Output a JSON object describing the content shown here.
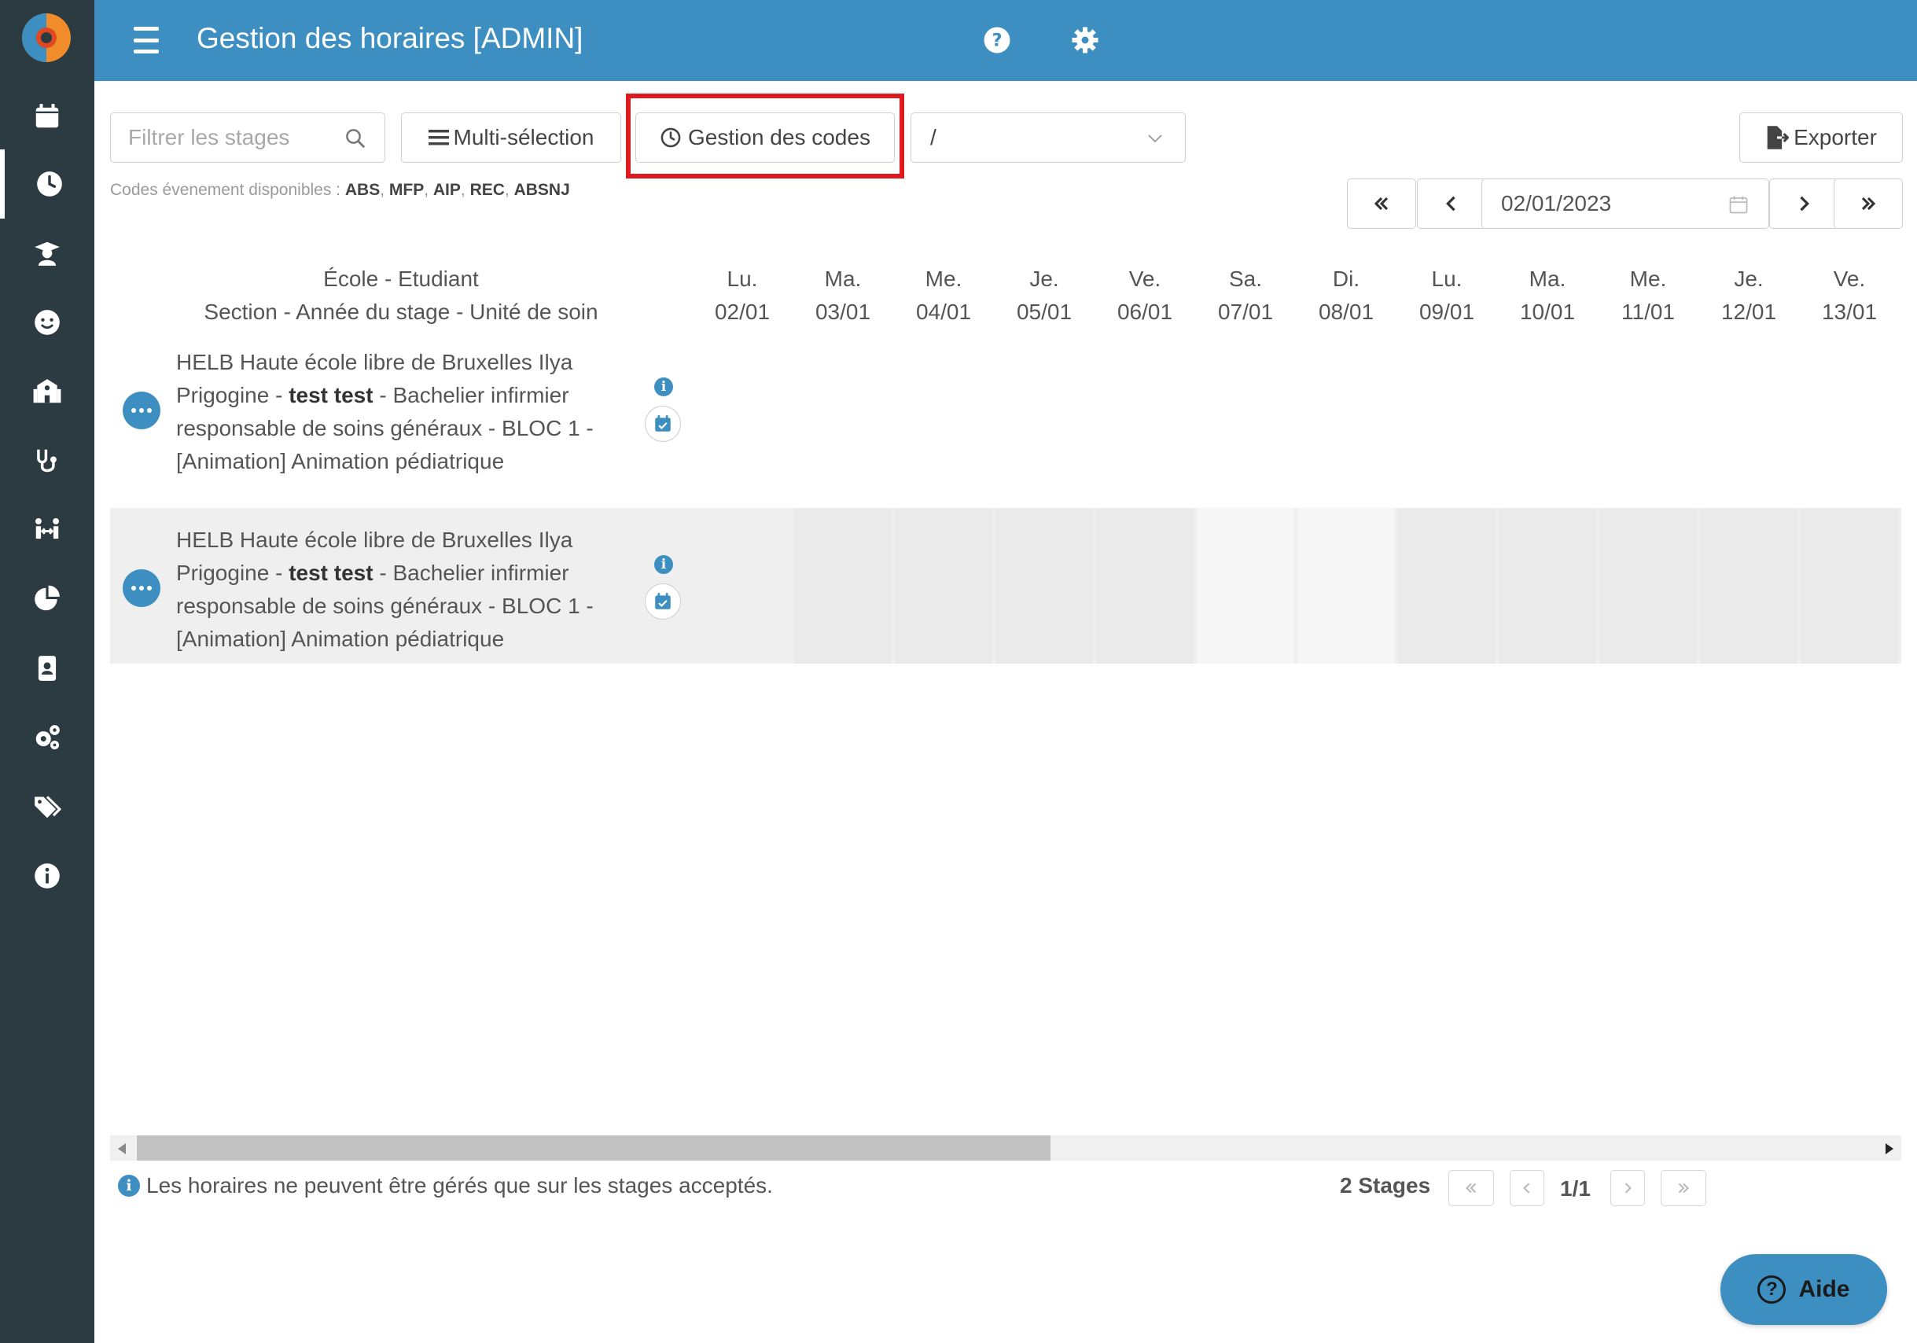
{
  "header": {
    "title": "Gestion des horaires [ADMIN]"
  },
  "toolbar": {
    "search_placeholder": "Filtrer les stages",
    "multi_label": "Multi-sélection",
    "gestion_label": "Gestion des codes",
    "select_value": "/",
    "export_label": "Exporter"
  },
  "codes": {
    "prefix": "Codes évenement disponibles :",
    "list": [
      "ABS",
      "MFP",
      "AIP",
      "REC",
      "ABSNJ"
    ]
  },
  "date_nav": {
    "date": "02/01/2023"
  },
  "table": {
    "head_line1": "École - Etudiant",
    "head_line2": "Section - Année du stage - Unité de soin",
    "days": [
      {
        "day": "Lu.",
        "date": "02/01"
      },
      {
        "day": "Ma.",
        "date": "03/01"
      },
      {
        "day": "Me.",
        "date": "04/01"
      },
      {
        "day": "Je.",
        "date": "05/01"
      },
      {
        "day": "Ve.",
        "date": "06/01"
      },
      {
        "day": "Sa.",
        "date": "07/01"
      },
      {
        "day": "Di.",
        "date": "08/01"
      },
      {
        "day": "Lu.",
        "date": "09/01"
      },
      {
        "day": "Ma.",
        "date": "10/01"
      },
      {
        "day": "Me.",
        "date": "11/01"
      },
      {
        "day": "Je.",
        "date": "12/01"
      },
      {
        "day": "Ve.",
        "date": "13/01"
      }
    ],
    "rows": [
      {
        "school": "HELB Haute école libre de Bruxelles Ilya Prigogine",
        "student": "test test",
        "details": "Bachelier infirmier responsable de soins généraux - BLOC 1 - [Animation] Animation pédiatrique"
      },
      {
        "school": "HELB Haute école libre de Bruxelles Ilya Prigogine",
        "student": "test test",
        "details": "Bachelier infirmier responsable de soins généraux - BLOC 1 - [Animation] Animation pédiatrique"
      }
    ]
  },
  "footer": {
    "info": "Les horaires ne peuvent être gérés que sur les stages acceptés.",
    "stages_count": "2 Stages",
    "page": "1/1"
  },
  "aide": {
    "label": "Aide"
  },
  "sidebar": {
    "items": [
      "calendar-icon",
      "clock-icon",
      "graduation-icon",
      "smile-icon",
      "school-icon",
      "stethoscope-icon",
      "users-icon",
      "pie-chart-icon",
      "badge-icon",
      "cogs-icon",
      "tags-icon",
      "info-icon"
    ]
  },
  "colors": {
    "header": "#3d8fc1",
    "sidebar": "#2c3a41",
    "highlight": "#e0191f"
  }
}
